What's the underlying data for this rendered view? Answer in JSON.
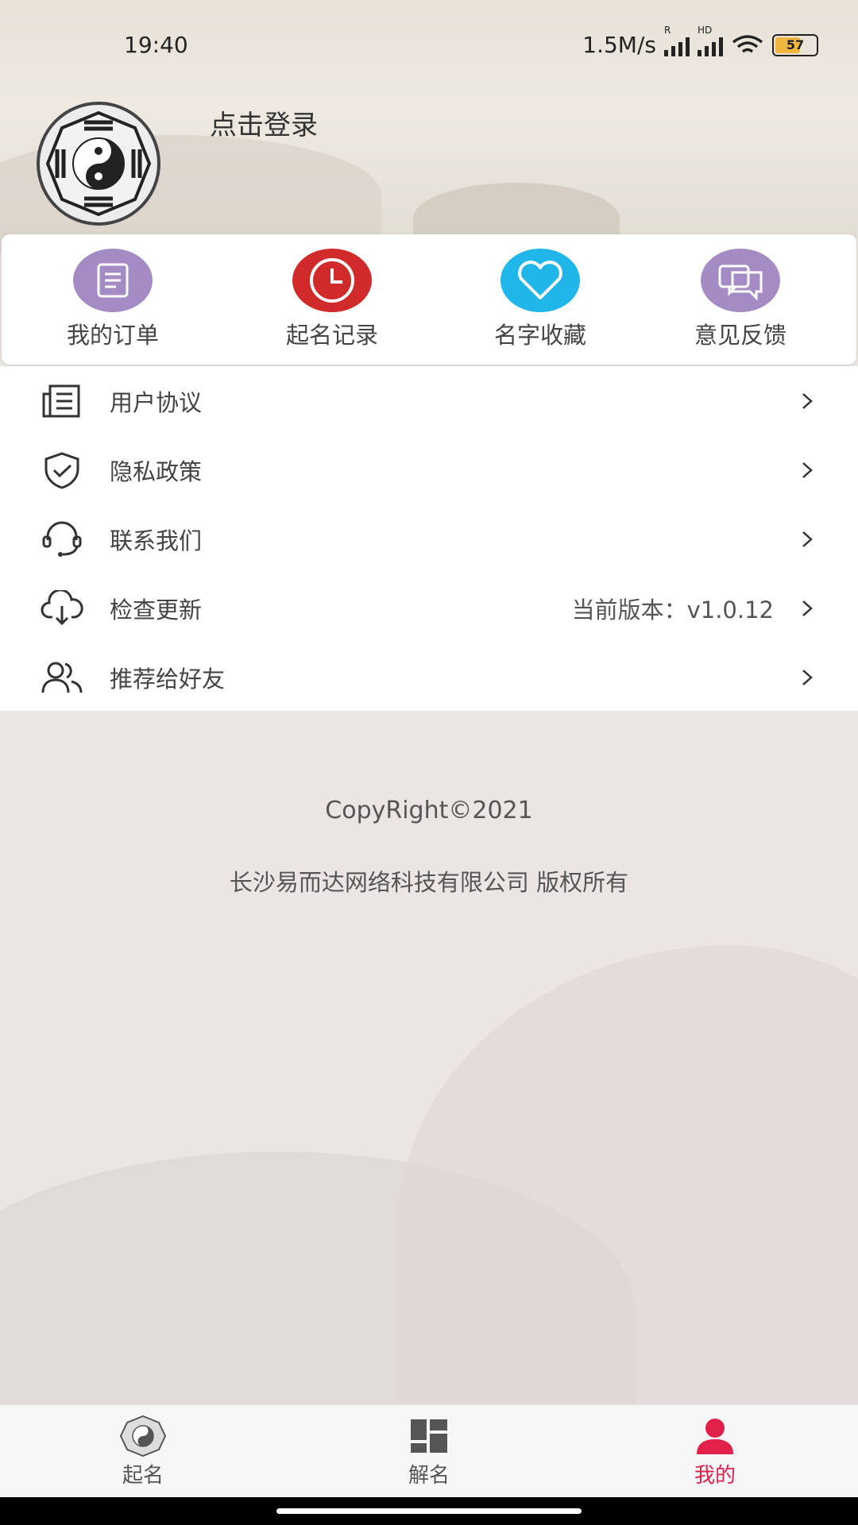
{
  "status_bar": {
    "time": "19:40",
    "network_speed": "1.5M/s",
    "signal1_label": "R",
    "signal2_label": "HD",
    "battery_level": "57"
  },
  "profile": {
    "login_prompt": "点击登录",
    "avatar_icon": "bagua-icon"
  },
  "quick_actions": [
    {
      "label": "我的订单",
      "icon": "document-icon",
      "color": "#a48bc4"
    },
    {
      "label": "起名记录",
      "icon": "clock-icon",
      "color": "#d02a2a"
    },
    {
      "label": "名字收藏",
      "icon": "heart-icon",
      "color": "#21b6ea"
    },
    {
      "label": "意见反馈",
      "icon": "chat-icon",
      "color": "#a48bc4"
    }
  ],
  "menu": [
    {
      "label": "用户协议",
      "icon": "document-list-icon",
      "value": ""
    },
    {
      "label": "隐私政策",
      "icon": "shield-check-icon",
      "value": ""
    },
    {
      "label": "联系我们",
      "icon": "headset-icon",
      "value": ""
    },
    {
      "label": "检查更新",
      "icon": "cloud-download-icon",
      "value": "当前版本：v1.0.12"
    },
    {
      "label": "推荐给好友",
      "icon": "users-icon",
      "value": ""
    }
  ],
  "footer": {
    "copyright": "CopyRight©2021",
    "company": "长沙易而达网络科技有限公司 版权所有"
  },
  "tabbar": {
    "tabs": [
      {
        "label": "起名",
        "icon": "bagua-icon",
        "active": false
      },
      {
        "label": "解名",
        "icon": "grid-icon",
        "active": false
      },
      {
        "label": "我的",
        "icon": "person-icon",
        "active": true
      }
    ],
    "active_color": "#e2214a"
  }
}
